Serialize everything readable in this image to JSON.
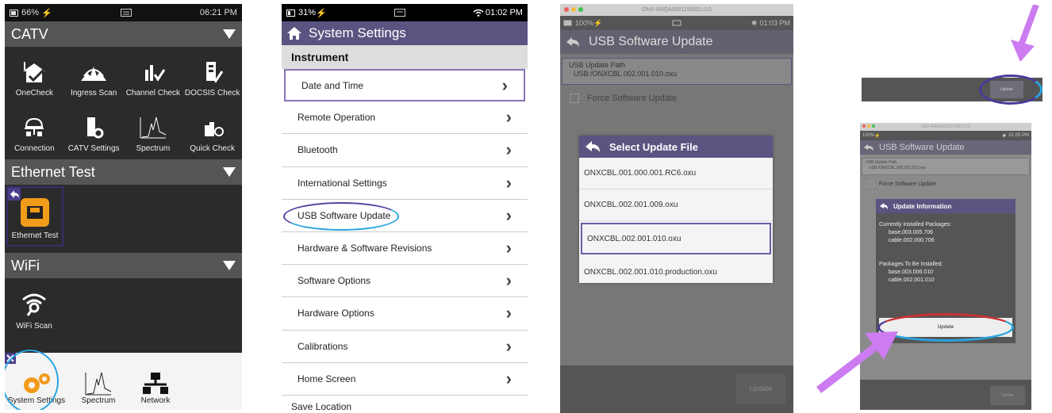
{
  "colors": {
    "accent_purple": "#5b5481",
    "highlight_blue": "#2aa4e0",
    "arrow_violet": "#cc7cf0",
    "orange_icon": "#f19b1b"
  },
  "panel1": {
    "status": {
      "battery": "66%",
      "time": "06:21 PM"
    },
    "sections": {
      "catv": {
        "title": "CATV",
        "tiles": [
          {
            "label": "OneCheck",
            "icon": "house-check-icon"
          },
          {
            "label": "Ingress Scan",
            "icon": "ingress-icon"
          },
          {
            "label": "Channel Check",
            "icon": "channel-check-icon"
          },
          {
            "label": "DOCSIS Check",
            "icon": "docsis-icon"
          },
          {
            "label": "Connection",
            "icon": "connection-icon"
          },
          {
            "label": "CATV Settings",
            "icon": "catv-settings-icon"
          },
          {
            "label": "Spectrum",
            "icon": "spectrum-icon"
          },
          {
            "label": "Quick Check",
            "icon": "quick-check-icon"
          }
        ]
      },
      "ethernet": {
        "title": "Ethernet Test",
        "tile_label": "Ethernet Test"
      },
      "wifi": {
        "title": "WiFi",
        "tile_label": "WiFi Scan"
      }
    },
    "bottom": {
      "system_settings": "System Settings",
      "spectrum": "Spectrum",
      "network": "Network"
    }
  },
  "panel2": {
    "status": {
      "battery": "31%",
      "time": "01:02 PM"
    },
    "title": "System Settings",
    "section": "Instrument",
    "items": [
      "Date and Time",
      "Remote Operation",
      "Bluetooth",
      "International Settings",
      "USB Software Update",
      "Hardware & Software Revisions",
      "Software Options",
      "Hardware Options",
      "Calibrations",
      "Home Screen",
      "Save Location"
    ]
  },
  "panel3": {
    "window_title": "ONX-ARQA0001150001:0.0",
    "status": {
      "battery": "100%",
      "time": "01:03 PM"
    },
    "title": "USB Software Update",
    "path_label": "USB Update Path",
    "path_value": "USB:/ONXCBL.002.001.010.oxu",
    "force_label": "Force Software Update",
    "dialog_title": "Select Update File",
    "files": [
      "ONXCBL.001.000.001.RC6.oxu",
      "ONXCBL.002.001.009.oxu",
      "ONXCBL.002.001.010.oxu",
      "ONXCBL.002.001.010.production.oxu"
    ],
    "update_button": "Update"
  },
  "panel4": {
    "top_button": "Update",
    "window_title": "ONX-ARQA0001150001:0.0",
    "status": {
      "battery": "100%",
      "time": "01:05 PM"
    },
    "title": "USB Software Update",
    "path_label": "USB Update Path",
    "path_value": "USB:/ONXCBL.002.001.010.oxu",
    "force_label": "Force Software Update",
    "info_title": "Update Information",
    "installed_label": "Currently Installed Packages:",
    "installed": [
      "base.003.005.706",
      "cable.002.000.706"
    ],
    "tobe_label": "Packages To Be Installed:",
    "tobe": [
      "base.003.006.010",
      "cable.002.001.010"
    ],
    "dialog_update": "Update",
    "footer_update": "Update"
  }
}
